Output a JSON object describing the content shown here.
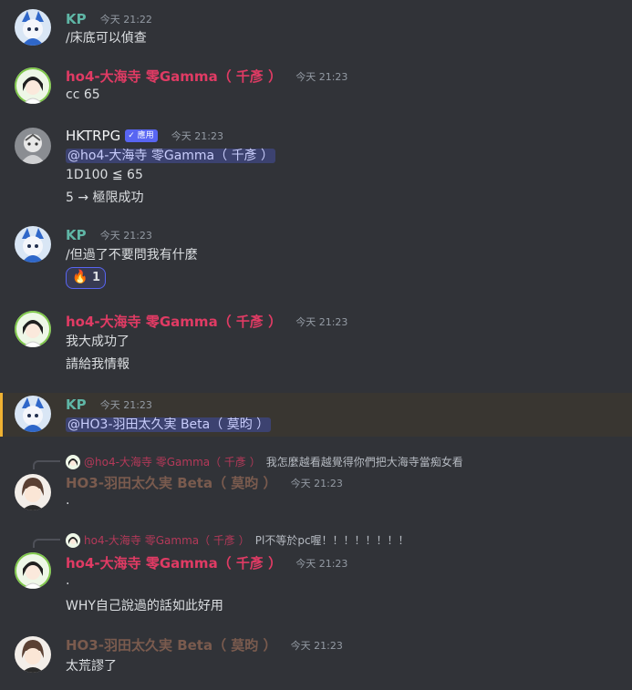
{
  "users": {
    "kp": "KP",
    "ho4": "ho4-大海寺 零Gamma（ 千彥 ）",
    "hktrpg": "HKTRPG",
    "ho3": "HO3-羽田太久実 Beta（ 莫昀 ）",
    "app_badge": "應用"
  },
  "messages": [
    {
      "author": "KP",
      "time": "今天 21:22",
      "lines": [
        "/床底可以偵查"
      ]
    },
    {
      "author": "ho4-大海寺 零Gamma（ 千彥 ）",
      "time": "今天 21:23",
      "lines": [
        "cc 65"
      ]
    },
    {
      "author": "HKTRPG",
      "time": "今天 21:23",
      "mention": "@ho4-大海寺 零Gamma（ 千彥 ）",
      "lines": [
        "1D100 ≦ 65",
        "5 → 極限成功"
      ]
    },
    {
      "author": "KP",
      "time": "今天 21:23",
      "lines": [
        "/但過了不要問我有什麼"
      ],
      "reaction": {
        "emoji": "🔥",
        "count": "1"
      }
    },
    {
      "author": "ho4-大海寺 零Gamma（ 千彥 ）",
      "time": "今天 21:23",
      "lines": [
        "我大成功了",
        "請給我情報"
      ]
    },
    {
      "author": "KP",
      "time": "今天 21:23",
      "mention": "@HO3-羽田太久実 Beta（ 莫昀 ）"
    },
    {
      "reply_to": "@ho4-大海寺 零Gamma（ 千彥 ）",
      "reply_text": "我怎麼越看越覺得你們把大海寺當痴女看",
      "author": "HO3-羽田太久実 Beta（ 莫昀 ）",
      "time": "今天 21:23",
      "lines": [
        "."
      ]
    },
    {
      "reply_to": "ho4-大海寺 零Gamma（ 千彥 ）",
      "reply_text": "Pl不等於pc喔！！！！！！！！",
      "author": "ho4-大海寺 零Gamma（ 千彥 ）",
      "time": "今天 21:23",
      "lines": [
        ".",
        "WHY自己說過的話如此好用"
      ]
    },
    {
      "author": "HO3-羽田太久実 Beta（ 莫昀 ）",
      "time": "今天 21:23",
      "lines": [
        "太荒謬了"
      ]
    }
  ],
  "colors": {
    "background": "#313338",
    "kp": "#5fb6a6",
    "ho4": "#e03b64",
    "ho3": "#7a5b4e",
    "mention_bg": "#3c4270",
    "highlight_border": "#f0b232"
  },
  "icons": {
    "reaction_emoji": "fire-emoji",
    "app_badge_check": "check-icon"
  }
}
